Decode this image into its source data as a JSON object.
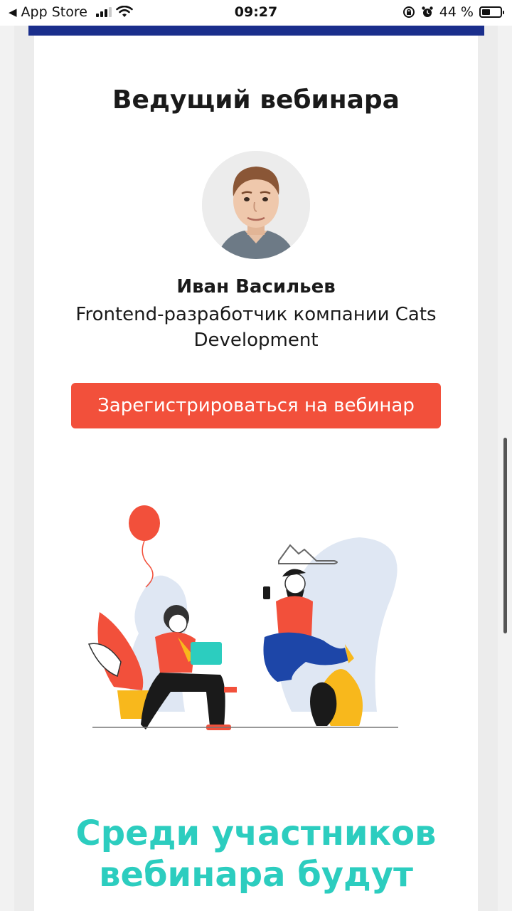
{
  "status_bar": {
    "back_label": "App Store",
    "time": "09:27",
    "battery_percent": "44 %",
    "battery_level": 0.44
  },
  "speaker_section": {
    "title": "Ведущий вебинара",
    "name": "Иван Васильев",
    "role": "Frontend-разработчик компании Cats Development"
  },
  "register_button": {
    "label": "Зарегистрироваться на вебинар"
  },
  "bottom_section": {
    "title_line1": "Среди участников",
    "title_line2": "вебинара будут"
  },
  "colors": {
    "accent_red": "#f2503b",
    "teal_heading": "#2ccdbf",
    "top_band": "#1a2e8c"
  }
}
